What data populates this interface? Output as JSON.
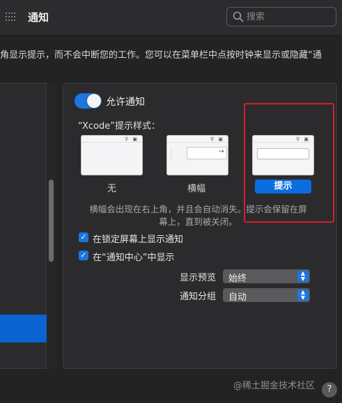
{
  "window": {
    "title": "通知"
  },
  "search": {
    "placeholder": "搜索"
  },
  "description": "角显示提示，而不会中断您的工作。您可以在菜单栏中点按时钟来显示或隐藏“通",
  "settings": {
    "allow_label": "允许通知",
    "allow_enabled": true,
    "style_label": "“Xcode”提示样式：",
    "styles": [
      {
        "name": "无",
        "selected": false
      },
      {
        "name": "横幅",
        "selected": false
      },
      {
        "name": "提示",
        "selected": true
      }
    ],
    "help_text_line1": "横幅会出现在右上角，并且会自动消失。提示会保留在屏",
    "help_text_line2": "幕上，直到被关闭。",
    "checkboxes": [
      {
        "label": "在锁定屏幕上显示通知",
        "checked": true
      },
      {
        "label": "在“通知中心”中显示",
        "checked": true
      }
    ],
    "show_preview": {
      "label": "显示预览",
      "value": "始终"
    },
    "grouping": {
      "label": "通知分组",
      "value": "自动"
    }
  },
  "colors": {
    "accent": "#1b76e0",
    "highlight_box": "#d21f2c",
    "background": "#232324"
  },
  "watermark": "@稀土掘金技术社区",
  "help_button": "?"
}
